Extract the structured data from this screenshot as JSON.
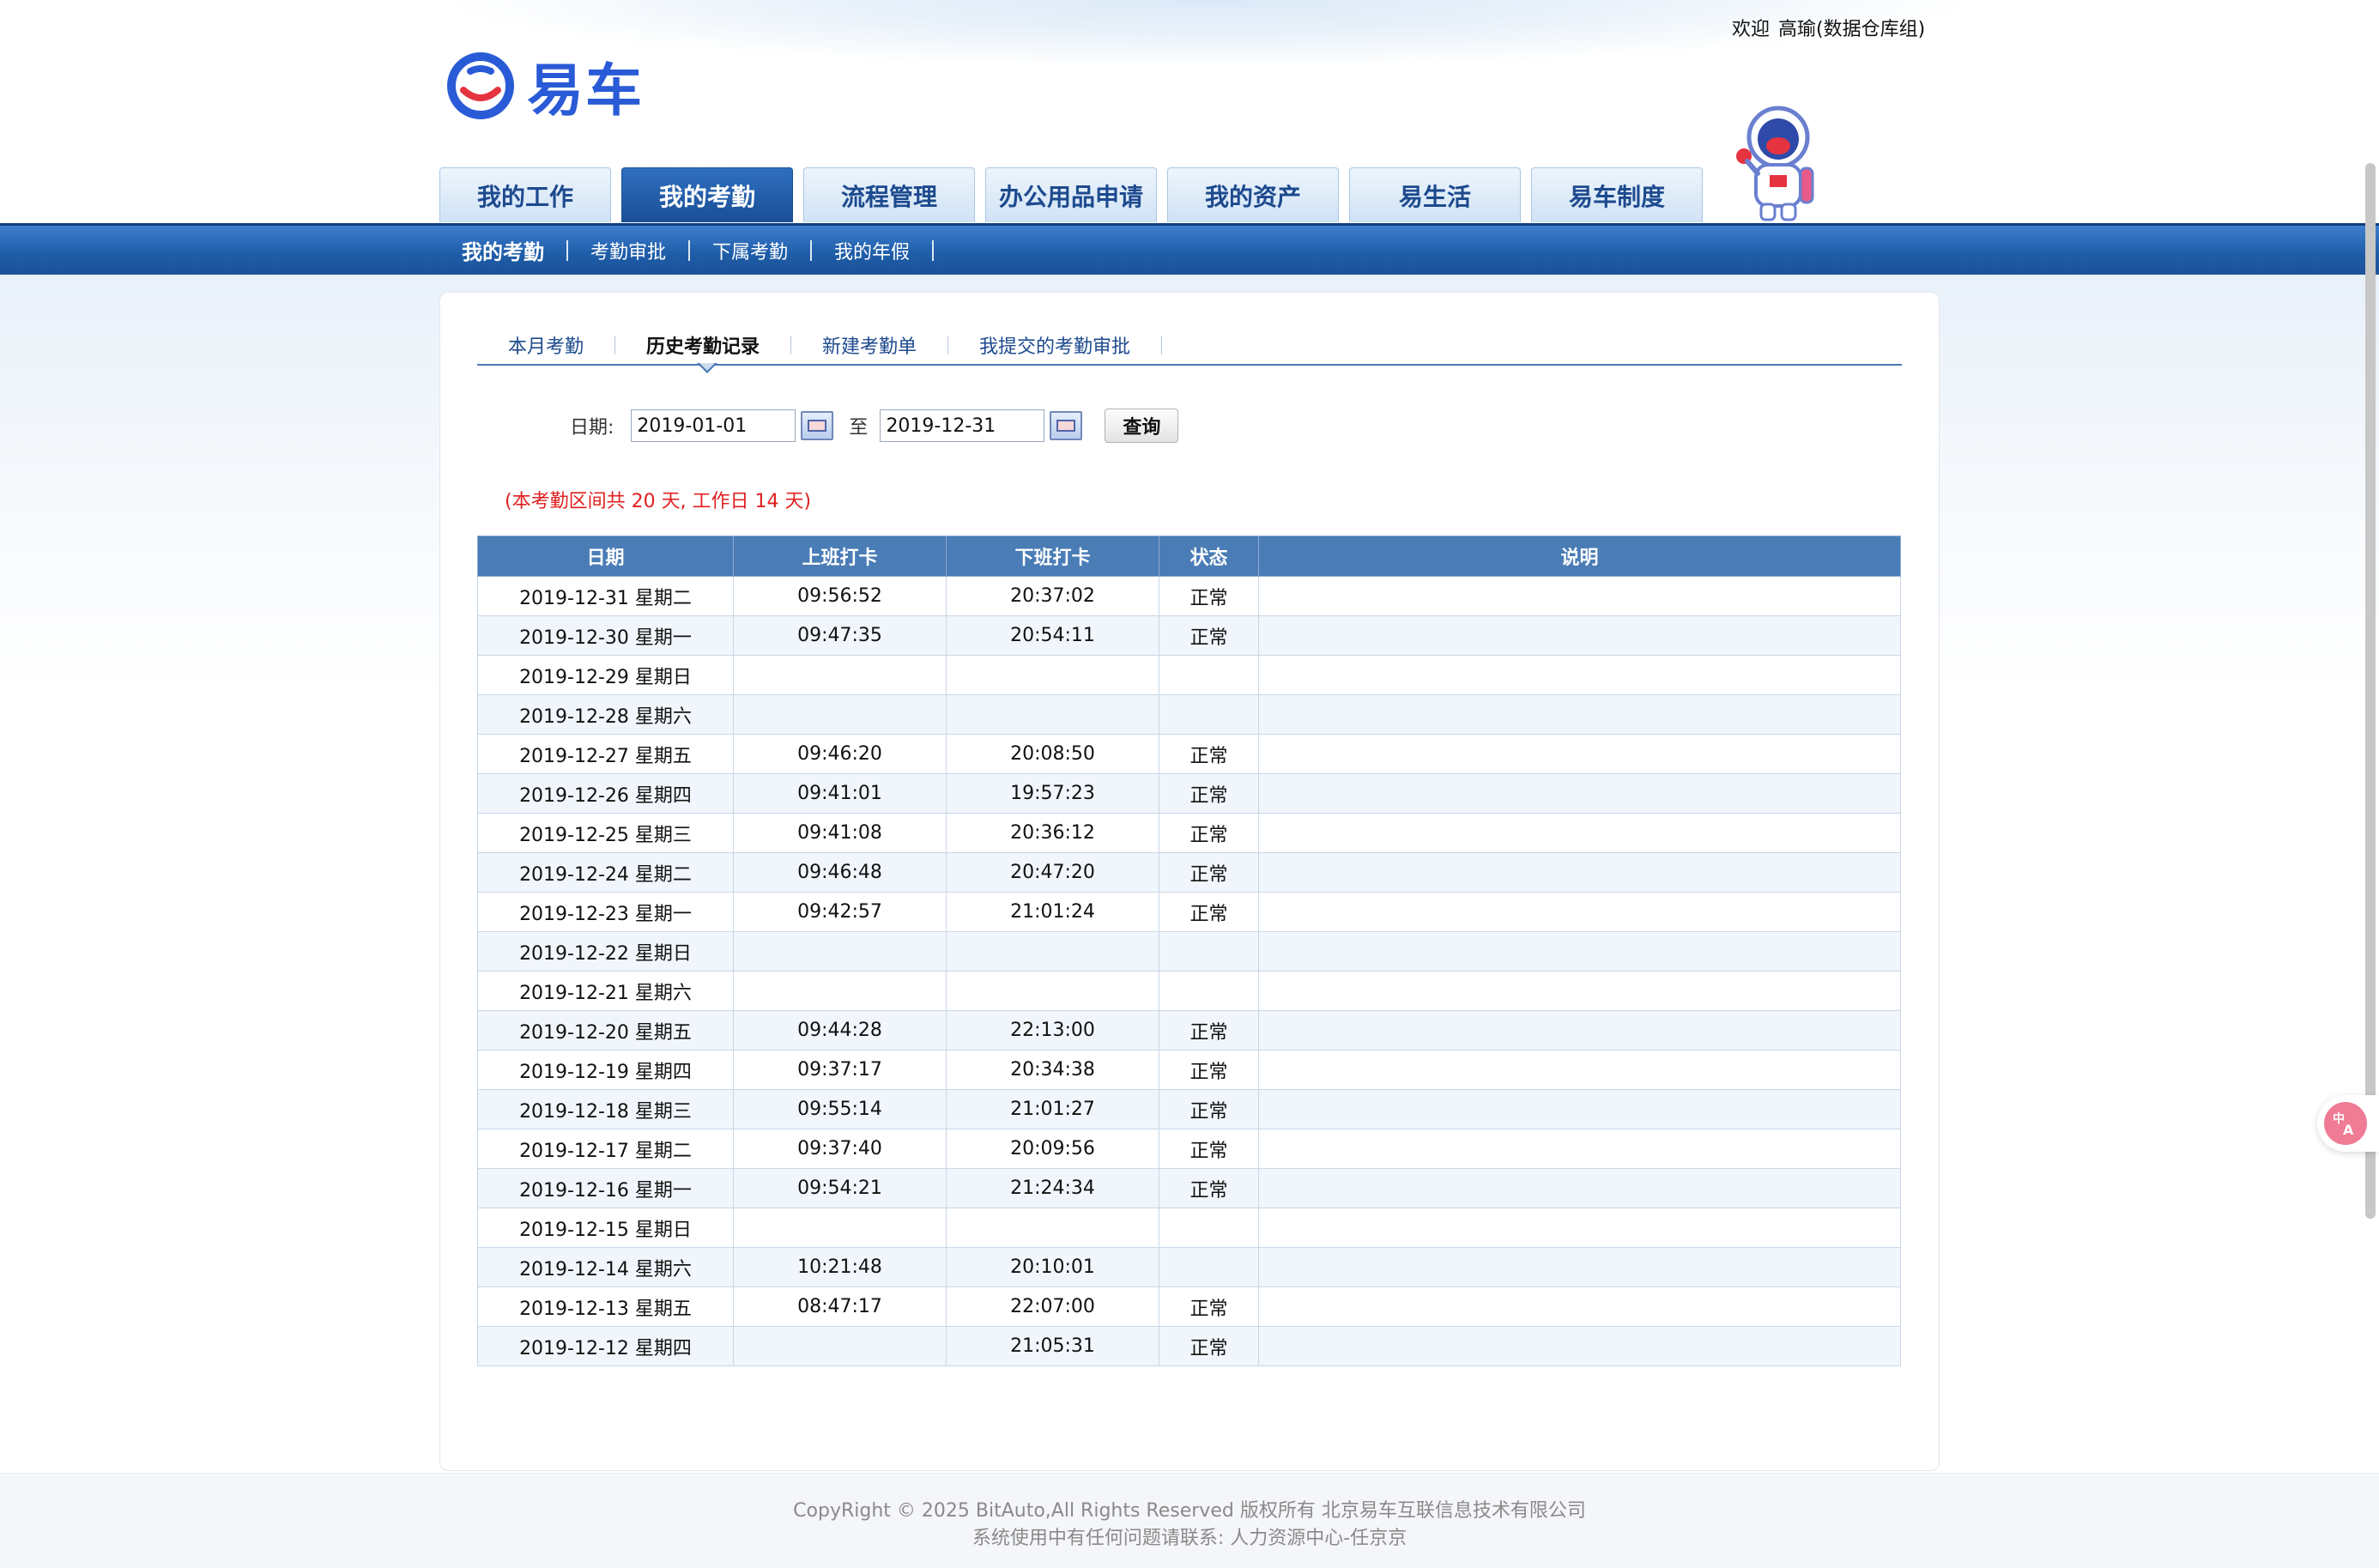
{
  "header": {
    "welcome": "欢迎",
    "user": "高瑜(数据仓库组)",
    "logo_text": "易车"
  },
  "nav": {
    "tabs": [
      {
        "label": "我的工作"
      },
      {
        "label": "我的考勤"
      },
      {
        "label": "流程管理"
      },
      {
        "label": "办公用品申请"
      },
      {
        "label": "我的资产"
      },
      {
        "label": "易生活"
      },
      {
        "label": "易车制度"
      }
    ],
    "active_index": 1
  },
  "subnav": {
    "items": [
      {
        "label": "我的考勤"
      },
      {
        "label": "考勤审批"
      },
      {
        "label": "下属考勤"
      },
      {
        "label": "我的年假"
      }
    ]
  },
  "subtabs": {
    "items": [
      {
        "label": "本月考勤"
      },
      {
        "label": "历史考勤记录"
      },
      {
        "label": "新建考勤单"
      },
      {
        "label": "我提交的考勤审批"
      }
    ],
    "active_index": 1
  },
  "filter": {
    "date_label": "日期:",
    "start_date": "2019-01-01",
    "to_label": "至",
    "end_date": "2019-12-31",
    "query_label": "查询"
  },
  "notice": "(本考勤区间共 20 天, 工作日 14 天)",
  "table": {
    "headers": [
      "日期",
      "上班打卡",
      "下班打卡",
      "状态",
      "说明"
    ],
    "rows": [
      [
        "2019-12-31 星期二",
        "09:56:52",
        "20:37:02",
        "正常",
        ""
      ],
      [
        "2019-12-30 星期一",
        "09:47:35",
        "20:54:11",
        "正常",
        ""
      ],
      [
        "2019-12-29 星期日",
        "",
        "",
        "",
        ""
      ],
      [
        "2019-12-28 星期六",
        "",
        "",
        "",
        ""
      ],
      [
        "2019-12-27 星期五",
        "09:46:20",
        "20:08:50",
        "正常",
        ""
      ],
      [
        "2019-12-26 星期四",
        "09:41:01",
        "19:57:23",
        "正常",
        ""
      ],
      [
        "2019-12-25 星期三",
        "09:41:08",
        "20:36:12",
        "正常",
        ""
      ],
      [
        "2019-12-24 星期二",
        "09:46:48",
        "20:47:20",
        "正常",
        ""
      ],
      [
        "2019-12-23 星期一",
        "09:42:57",
        "21:01:24",
        "正常",
        ""
      ],
      [
        "2019-12-22 星期日",
        "",
        "",
        "",
        ""
      ],
      [
        "2019-12-21 星期六",
        "",
        "",
        "",
        ""
      ],
      [
        "2019-12-20 星期五",
        "09:44:28",
        "22:13:00",
        "正常",
        ""
      ],
      [
        "2019-12-19 星期四",
        "09:37:17",
        "20:34:38",
        "正常",
        ""
      ],
      [
        "2019-12-18 星期三",
        "09:55:14",
        "21:01:27",
        "正常",
        ""
      ],
      [
        "2019-12-17 星期二",
        "09:37:40",
        "20:09:56",
        "正常",
        ""
      ],
      [
        "2019-12-16 星期一",
        "09:54:21",
        "21:24:34",
        "正常",
        ""
      ],
      [
        "2019-12-15 星期日",
        "",
        "",
        "",
        ""
      ],
      [
        "2019-12-14 星期六",
        "10:21:48",
        "20:10:01",
        "",
        ""
      ],
      [
        "2019-12-13 星期五",
        "08:47:17",
        "22:07:00",
        "正常",
        ""
      ],
      [
        "2019-12-12 星期四",
        "",
        "21:05:31",
        "正常",
        ""
      ]
    ]
  },
  "footer": {
    "copyright": "CopyRight © 2025 BitAuto,All Rights Reserved 版权所有 北京易车互联信息技术有限公司",
    "contact": "系统使用中有任何问题请联系: 人力资源中心-任京京"
  },
  "floating": {
    "icon": "translate-icon"
  }
}
